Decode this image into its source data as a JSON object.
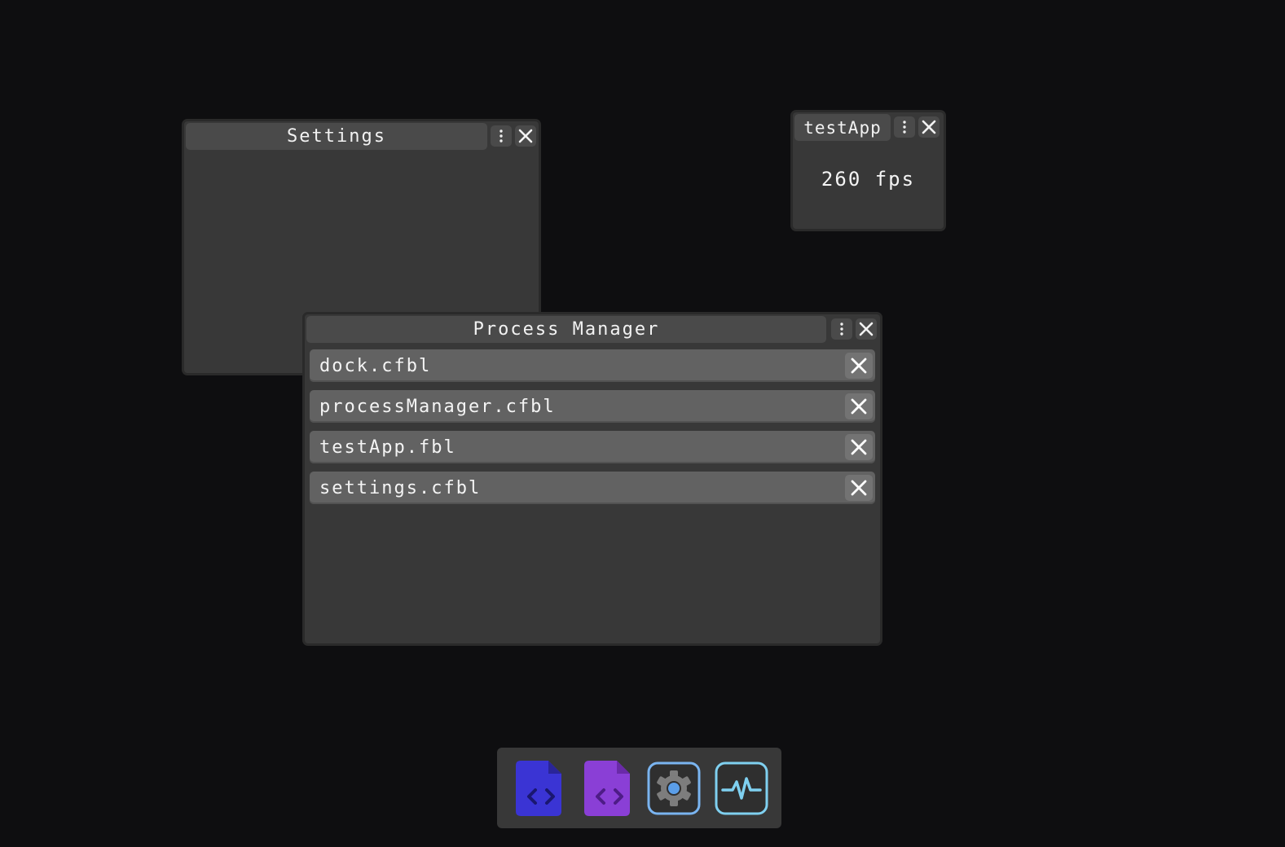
{
  "colors": {
    "desktop": "#0e0e10",
    "window_body": "#383838",
    "titlebar": "#4a4a4a",
    "row": "#626262",
    "dock_code_blue": "#3a34d4",
    "dock_code_purple": "#8a3fd6",
    "dock_settings_ring": "#7ab4f0",
    "dock_monitor": "#7fd0f0"
  },
  "settings_window": {
    "title": "Settings"
  },
  "testapp_window": {
    "title": "testApp",
    "fps_label": "260 fps"
  },
  "process_manager": {
    "title": "Process Manager",
    "processes": [
      {
        "name": "dock.cfbl"
      },
      {
        "name": "processManager.cfbl"
      },
      {
        "name": "testApp.fbl"
      },
      {
        "name": "settings.cfbl"
      }
    ]
  },
  "dock": {
    "items": [
      {
        "icon": "code-file-blue-icon"
      },
      {
        "icon": "code-file-purple-icon"
      },
      {
        "icon": "settings-gear-icon"
      },
      {
        "icon": "activity-monitor-icon"
      }
    ]
  }
}
